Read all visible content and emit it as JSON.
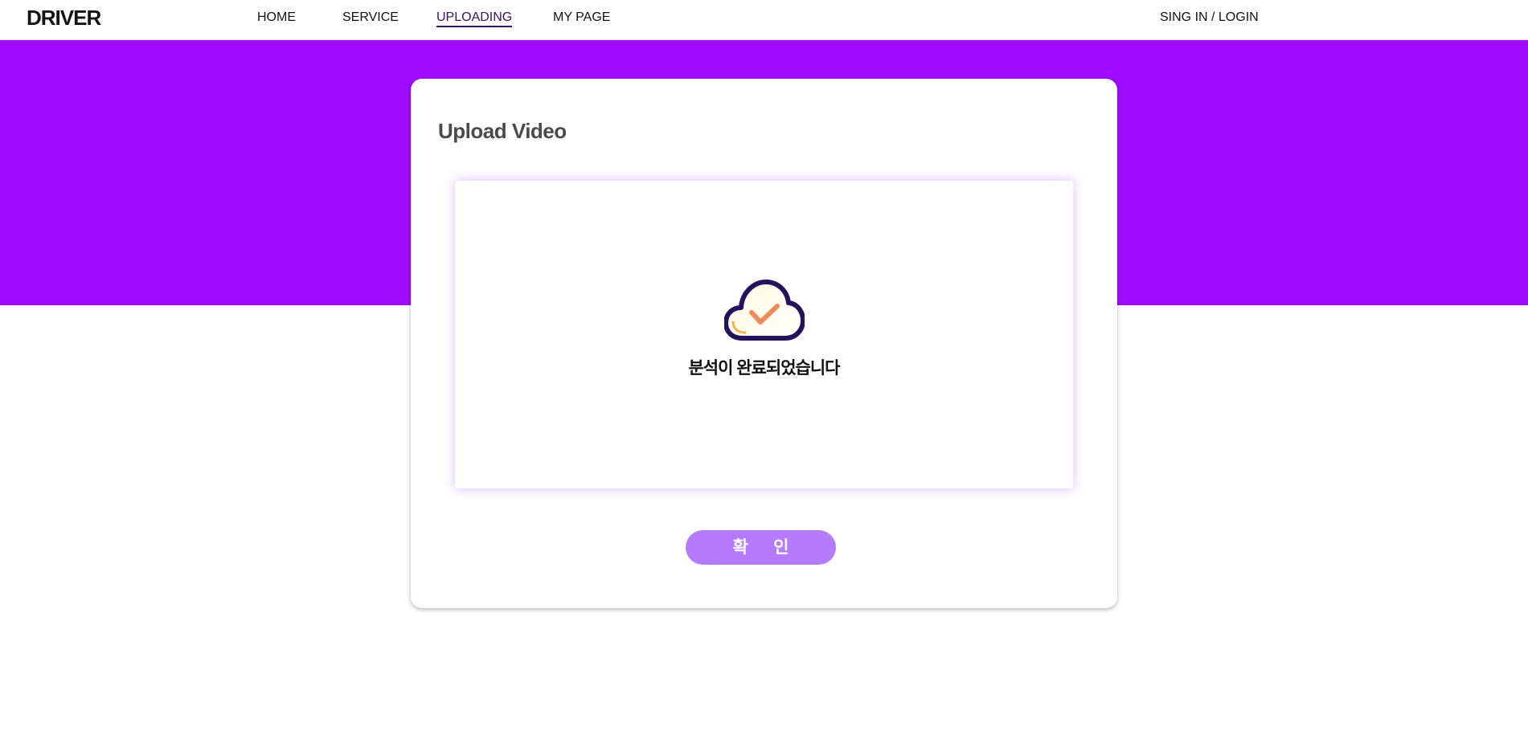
{
  "app": {
    "logo": "DRIVER"
  },
  "nav": {
    "items": [
      {
        "label": "HOME",
        "active": false
      },
      {
        "label": "SERVICE",
        "active": false
      },
      {
        "label": "UPLOADING",
        "active": true
      },
      {
        "label": "MY PAGE",
        "active": false
      }
    ],
    "login_label": "SING IN / LOGIN"
  },
  "colors": {
    "hero_background": "#a10bff",
    "button_background": "#b57bff",
    "active_nav_color": "#3a1063",
    "icon_outline": "#23135e",
    "icon_check": "#ef8a5a"
  },
  "upload": {
    "title": "Upload Video",
    "icon": "cloud-check-icon",
    "status_text": "분석이 완료되었습니다",
    "confirm_label": "확 인"
  }
}
